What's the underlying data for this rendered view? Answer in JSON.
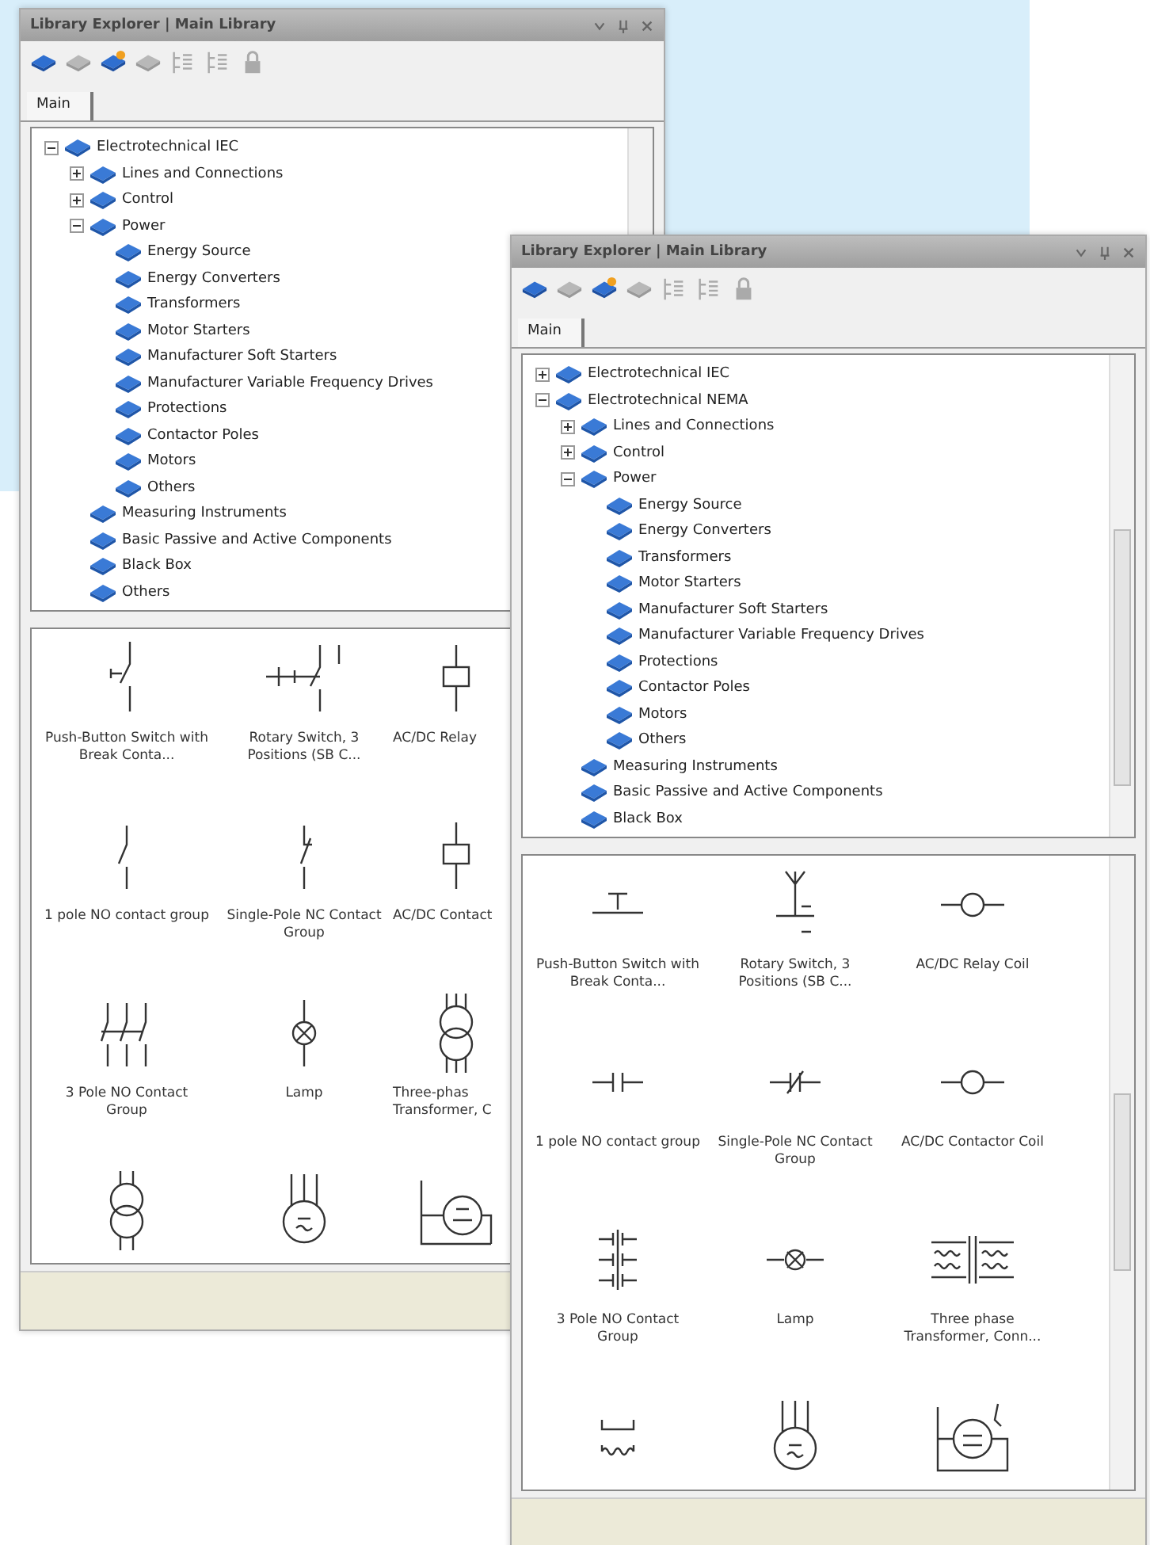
{
  "windows": [
    {
      "title": "Library Explorer | Main Library",
      "toolbar": [
        {
          "kind": "book",
          "disabled": false
        },
        {
          "kind": "book",
          "disabled": true
        },
        {
          "kind": "book-star",
          "disabled": false
        },
        {
          "kind": "book",
          "disabled": true
        },
        {
          "kind": "list",
          "disabled": true
        },
        {
          "kind": "list",
          "disabled": true
        },
        {
          "kind": "lock",
          "disabled": true
        }
      ],
      "tabs": [
        {
          "label": "Main",
          "selected": true
        }
      ],
      "tree": [
        {
          "label": "Electrotechnical IEC",
          "expanded": true,
          "children": [
            {
              "label": "Lines and Connections",
              "expanded": false
            },
            {
              "label": "Control",
              "expanded": false
            },
            {
              "label": "Power",
              "expanded": true,
              "children": [
                {
                  "label": "Energy Source"
                },
                {
                  "label": "Energy Converters"
                },
                {
                  "label": "Transformers"
                },
                {
                  "label": "Motor Starters"
                },
                {
                  "label": "Manufacturer Soft Starters"
                },
                {
                  "label": "Manufacturer Variable Frequency Drives"
                },
                {
                  "label": "Protections"
                },
                {
                  "label": "Contactor Poles"
                },
                {
                  "label": "Motors"
                },
                {
                  "label": "Others"
                }
              ]
            },
            {
              "label": "Measuring Instruments"
            },
            {
              "label": "Basic Passive and Active Components"
            },
            {
              "label": "Black Box"
            },
            {
              "label": "Others"
            }
          ]
        }
      ],
      "symbols": [
        {
          "kind": "iec-pushbutton",
          "label": "Push-Button Switch with Break Conta..."
        },
        {
          "kind": "iec-rotary",
          "label": "Rotary Switch, 3 Positions (SB C..."
        },
        {
          "kind": "iec-coil",
          "label": "AC/DC Relay"
        },
        {
          "kind": "iec-no",
          "label": "1 pole NO contact group"
        },
        {
          "kind": "iec-nc",
          "label": "Single-Pole NC Contact Group"
        },
        {
          "kind": "iec-coil",
          "label": "AC/DC Contact"
        },
        {
          "kind": "iec-3pole",
          "label": "3 Pole NO Contact Group"
        },
        {
          "kind": "iec-lamp",
          "label": "Lamp"
        },
        {
          "kind": "iec-transformer-3ph",
          "label": "Three-phas Transformer, C"
        },
        {
          "kind": "iec-transformer"
        },
        {
          "kind": "motor-3ph"
        },
        {
          "kind": "motor-dc"
        }
      ]
    },
    {
      "title": "Library Explorer | Main Library",
      "toolbar": [
        {
          "kind": "book",
          "disabled": false
        },
        {
          "kind": "book",
          "disabled": true
        },
        {
          "kind": "book-star",
          "disabled": false
        },
        {
          "kind": "book",
          "disabled": true
        },
        {
          "kind": "list",
          "disabled": true
        },
        {
          "kind": "list",
          "disabled": true
        },
        {
          "kind": "lock",
          "disabled": true
        }
      ],
      "tabs": [
        {
          "label": "Main",
          "selected": true
        }
      ],
      "tree": [
        {
          "label": "Electrotechnical IEC",
          "expanded": false
        },
        {
          "label": "Electrotechnical NEMA",
          "expanded": true,
          "children": [
            {
              "label": "Lines and Connections",
              "expanded": false
            },
            {
              "label": "Control",
              "expanded": false
            },
            {
              "label": "Power",
              "expanded": true,
              "children": [
                {
                  "label": "Energy Source"
                },
                {
                  "label": "Energy Converters"
                },
                {
                  "label": "Transformers"
                },
                {
                  "label": "Motor Starters"
                },
                {
                  "label": "Manufacturer Soft Starters"
                },
                {
                  "label": "Manufacturer Variable Frequency Drives"
                },
                {
                  "label": "Protections"
                },
                {
                  "label": "Contactor Poles"
                },
                {
                  "label": "Motors"
                },
                {
                  "label": "Others"
                }
              ]
            },
            {
              "label": "Measuring Instruments"
            },
            {
              "label": "Basic Passive and Active Components"
            },
            {
              "label": "Black Box"
            }
          ]
        }
      ],
      "symbols": [
        {
          "kind": "nema-pushbutton",
          "label": "Push-Button Switch with Break Conta..."
        },
        {
          "kind": "nema-rotary",
          "label": "Rotary Switch, 3 Positions (SB C..."
        },
        {
          "kind": "nema-coil",
          "label": "AC/DC Relay Coil"
        },
        {
          "kind": "nema-no",
          "label": "1 pole NO contact group"
        },
        {
          "kind": "nema-nc",
          "label": "Single-Pole NC Contact Group"
        },
        {
          "kind": "nema-coil",
          "label": "AC/DC Contactor Coil"
        },
        {
          "kind": "nema-3pole",
          "label": "3 Pole NO Contact Group"
        },
        {
          "kind": "nema-lamp",
          "label": "Lamp"
        },
        {
          "kind": "nema-transformer-3ph",
          "label": "Three phase Transformer, Conn..."
        },
        {
          "kind": "nema-transformer"
        },
        {
          "kind": "motor-3ph"
        },
        {
          "kind": "nema-motor-dc"
        }
      ]
    }
  ]
}
